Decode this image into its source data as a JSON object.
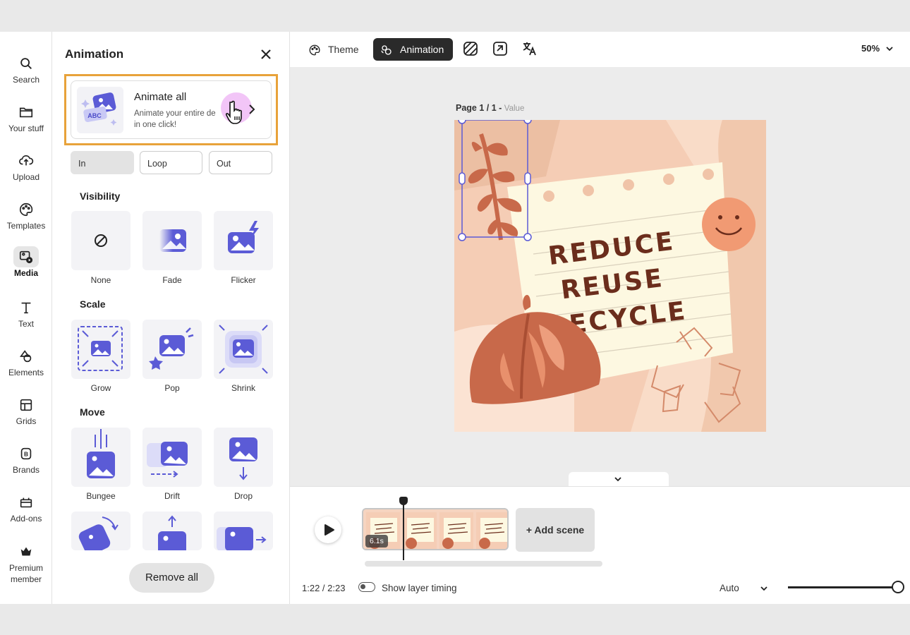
{
  "rail": {
    "items": [
      {
        "label": "Search",
        "icon": "search-icon"
      },
      {
        "label": "Your stuff",
        "icon": "folder-icon"
      },
      {
        "label": "Upload",
        "icon": "upload-icon"
      },
      {
        "label": "Templates",
        "icon": "templates-icon"
      },
      {
        "label": "Media",
        "icon": "media-icon",
        "active": true
      },
      {
        "label": "Text",
        "icon": "text-icon"
      },
      {
        "label": "Elements",
        "icon": "elements-icon"
      },
      {
        "label": "Grids",
        "icon": "grids-icon"
      },
      {
        "label": "Brands",
        "icon": "brands-icon"
      },
      {
        "label": "Add-ons",
        "icon": "addons-icon"
      },
      {
        "label": "Premium member",
        "icon": "crown-icon"
      }
    ]
  },
  "panel": {
    "title": "Animation",
    "animate_all": {
      "title": "Animate all",
      "description": "Animate your entire de... in one click!",
      "desc_line1": "Animate your entire de",
      "desc_line2": "in one click!",
      "thumb_text": "ABC"
    },
    "tabs": [
      {
        "label": "In",
        "selected": true
      },
      {
        "label": "Loop",
        "selected": false
      },
      {
        "label": "Out",
        "selected": false
      }
    ],
    "sections": [
      {
        "title": "Visibility",
        "items": [
          "None",
          "Fade",
          "Flicker"
        ]
      },
      {
        "title": "Scale",
        "items": [
          "Grow",
          "Pop",
          "Shrink"
        ]
      },
      {
        "title": "Move",
        "items": [
          "Bungee",
          "Drift",
          "Drop"
        ]
      }
    ],
    "remove_all_label": "Remove all"
  },
  "toolbar": {
    "theme_label": "Theme",
    "animation_label": "Animation",
    "zoom": "50%"
  },
  "canvas": {
    "page_label": "Page 1 / 1 - ",
    "page_value": "Value",
    "text_lines": [
      "REDUCE",
      "REUSE",
      "RECYCLE"
    ],
    "colors": {
      "background": "#f5cdb5",
      "note": "#fdf8e1",
      "accent": "#c8694a",
      "text": "#6b2d1c",
      "smiley": "#f19a73"
    }
  },
  "timeline": {
    "scene_duration": "6.1s",
    "add_scene_label": "Add scene",
    "time_readout": "1:22 / 2:23",
    "show_layer_timing_label": "Show layer timing",
    "speed_select": "Auto"
  }
}
